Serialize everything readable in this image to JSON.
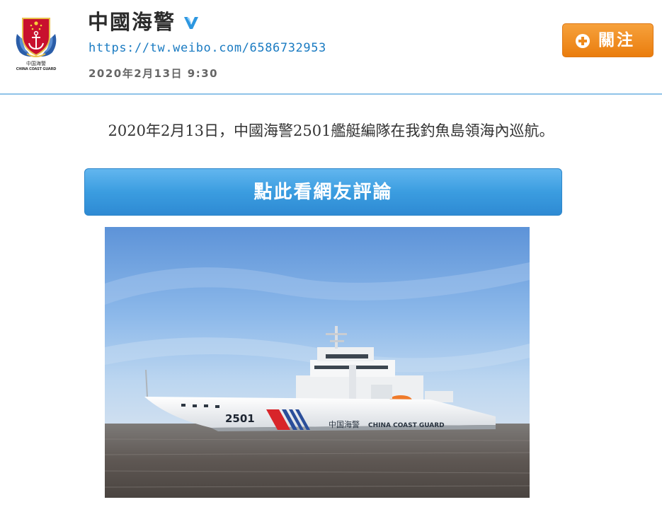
{
  "account": {
    "name": "中國海警",
    "url": "https://tw.weibo.com/6586732953",
    "date": "2020年2月13日 9:30",
    "logo_caption_cn": "中国海警",
    "logo_caption_en": "CHINA COAST GUARD"
  },
  "follow_button": {
    "label": "關注"
  },
  "post": {
    "text": "2020年2月13日，中國海警2501艦艇編隊在我釣魚島領海內巡航。"
  },
  "comment_button": {
    "label": "點此看網友評論"
  },
  "photo": {
    "hull_number": "2501",
    "hull_text_cn": "中国海警",
    "hull_text_en": "CHINA COAST GUARD"
  },
  "colors": {
    "accent_blue": "#1a7bc2",
    "follow_orange": "#ef8a1b",
    "divider": "#8fc3e8",
    "comment_button": "#3b9de0"
  },
  "icons": [
    "china-coast-guard-logo",
    "verified-v-icon",
    "plus-circle-icon"
  ]
}
